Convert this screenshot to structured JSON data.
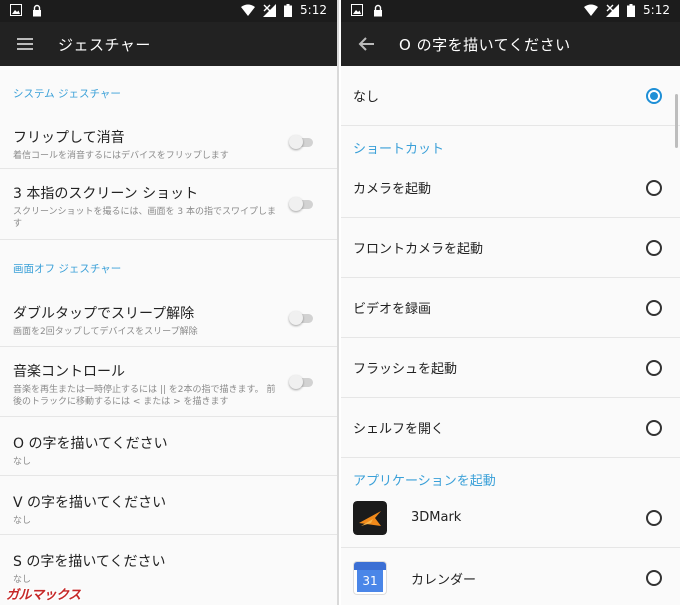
{
  "status": {
    "time": "5:12"
  },
  "left": {
    "title": "ジェスチャー",
    "section1": "システム ジェスチャー",
    "items1": [
      {
        "title": "フリップして消音",
        "sub": "着信コールを消音するにはデバイスをフリップします"
      },
      {
        "title": "3 本指のスクリーン ショット",
        "sub": "スクリーンショットを撮るには、画面を 3 本の指でスワイプします"
      }
    ],
    "section2": "画面オフ ジェスチャー",
    "items2": [
      {
        "title": "ダブルタップでスリープ解除",
        "sub": "画面を2回タップしてデバイスをスリープ解除"
      },
      {
        "title": "音楽コントロール",
        "sub": "音楽を再生または一時停止するには || を2本の指で描きます。 前後のトラックに移動するには < または > を描きます"
      },
      {
        "title": "O の字を描いてください",
        "sub": "なし"
      },
      {
        "title": "V の字を描いてください",
        "sub": "なし"
      },
      {
        "title": "S の字を描いてください",
        "sub": "なし"
      }
    ],
    "watermark": "ガルマックス"
  },
  "right": {
    "title": "O の字を描いてください",
    "none_label": "なし",
    "section_shortcut": "ショートカット",
    "shortcuts": [
      "カメラを起動",
      "フロントカメラを起動",
      "ビデオを録画",
      "フラッシュを起動",
      "シェルフを開く"
    ],
    "section_apps": "アプリケーションを起動",
    "apps": [
      {
        "name": "3DMark",
        "icon": "3dmark-app-icon"
      },
      {
        "name": "カレンダー",
        "icon": "calendar-app-icon",
        "icon_text": "31"
      }
    ],
    "selected": "なし"
  },
  "colors": {
    "accent": "#3aa0d8",
    "appbar": "#222222",
    "statusbar": "#1c1c1c",
    "radio_selected": "#1e8fd6"
  }
}
